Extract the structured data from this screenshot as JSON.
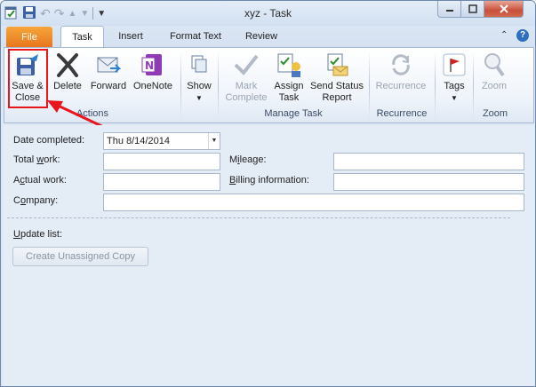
{
  "window": {
    "title": "xyz  -  Task"
  },
  "tabs": [
    "File",
    "Task",
    "Insert",
    "Format Text",
    "Review"
  ],
  "ribbon": {
    "actions": {
      "group_label": "Actions",
      "save_close": [
        "Save &",
        "Close"
      ],
      "delete": "Delete",
      "forward": "Forward",
      "onenote": "OneNote"
    },
    "show": {
      "label": "Show"
    },
    "manage_task": {
      "group_label": "Manage Task",
      "mark_complete": [
        "Mark",
        "Complete"
      ],
      "assign_task": [
        "Assign",
        "Task"
      ],
      "send_status": [
        "Send Status",
        "Report"
      ]
    },
    "recurrence": {
      "group_label": "Recurrence",
      "label": "Recurrence"
    },
    "tags": {
      "label": "Tags"
    },
    "zoom": {
      "group_label": "Zoom",
      "label": "Zoom"
    }
  },
  "form": {
    "date_completed": {
      "label": "Date completed:",
      "value": "Thu 8/14/2014"
    },
    "total_work": {
      "label_pre": "Total ",
      "label_u": "w",
      "label_post": "ork:",
      "value": ""
    },
    "actual_work": {
      "label_pre": "A",
      "label_u": "c",
      "label_post": "tual work:",
      "value": ""
    },
    "company": {
      "label_pre": "C",
      "label_u": "o",
      "label_post": "mpany:",
      "value": ""
    },
    "mileage": {
      "label_pre": "M",
      "label_u": "i",
      "label_post": "leage:",
      "value": ""
    },
    "billing": {
      "label_pre": "",
      "label_u": "B",
      "label_post": "illing information:",
      "value": ""
    },
    "update_list": {
      "label_pre": "",
      "label_u": "U",
      "label_post": "pdate list:"
    },
    "create_copy": "Create Unassigned Copy"
  }
}
